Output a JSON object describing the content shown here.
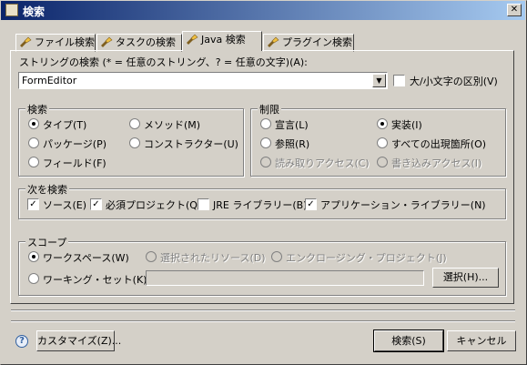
{
  "window": {
    "title": "検索",
    "close_glyph": "✕"
  },
  "tabs": [
    {
      "label": "ファイル検索",
      "icon": "flashlight-icon"
    },
    {
      "label": "タスクの検索",
      "icon": "flashlight-icon"
    },
    {
      "label": "Java 検索",
      "icon": "flashlight-icon"
    },
    {
      "label": "プラグイン検索",
      "icon": "flashlight-icon"
    }
  ],
  "search": {
    "label": "ストリングの検索 (* = 任意のストリング、? = 任意の文字)(A):",
    "value": "FormEditor",
    "case_label": "大/小文字の区別(V)",
    "case_checked": false
  },
  "search_for": {
    "title": "検索",
    "options": [
      "タイプ(T)",
      "メソッド(M)",
      "パッケージ(P)",
      "コンストラクター(U)",
      "フィールド(F)"
    ],
    "selected": "タイプ(T)"
  },
  "limit_to": {
    "title": "制限",
    "options": [
      "宣言(L)",
      "実装(I)",
      "参照(R)",
      "すべての出現箇所(O)",
      "読み取りアクセス(C)",
      "書き込みアクセス(I)"
    ],
    "selected": "実装(I)"
  },
  "search_in": {
    "title": "次を検索",
    "items": [
      {
        "label": "ソース(E)",
        "checked": true
      },
      {
        "label": "必須プロジェクト(Q)",
        "checked": true
      },
      {
        "label": "JRE ライブラリー(B)",
        "checked": false
      },
      {
        "label": "アプリケーション・ライブラリー(N)",
        "checked": true
      }
    ]
  },
  "scope": {
    "title": "スコープ",
    "workspace": "ワークスペース(W)",
    "selected_resources": "選択されたリソース(D)",
    "enclosing_projects": "エンクロージング・プロジェクト(J)",
    "working_set": "ワーキング・セット(K):",
    "choose_button": "選択(H)...",
    "selected": "ワークスペース(W)"
  },
  "buttons": {
    "customize": "カスタマイズ(Z)...",
    "search": "検索(S)",
    "cancel": "キャンセル"
  },
  "check_glyph": "✓",
  "help_glyph": "?",
  "dropdown_glyph": "▼"
}
